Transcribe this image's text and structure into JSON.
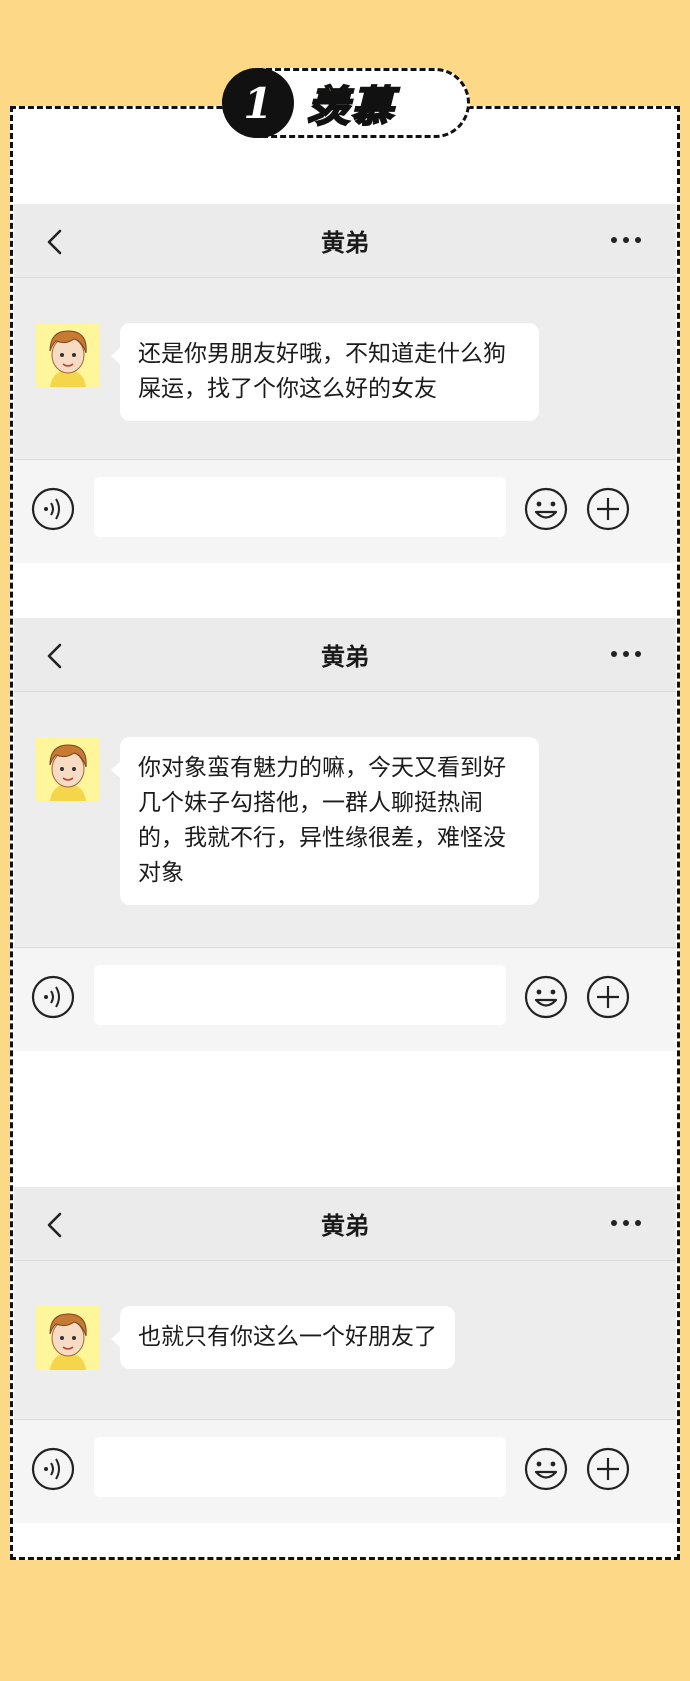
{
  "badge": {
    "number": "1",
    "text": "羡慕"
  },
  "chats": [
    {
      "title": "黄弟",
      "message": "还是你男朋友好哦，不知道走什么狗屎运，找了个你这么好的女友"
    },
    {
      "title": "黄弟",
      "message": "你对象蛮有魅力的嘛，今天又看到好几个妹子勾搭他，一群人聊挺热闹的，我就不行，异性缘很差，难怪没对象"
    },
    {
      "title": "黄弟",
      "message": "也就只有你这么一个好朋友了"
    }
  ],
  "icons": {
    "back": "chevron-left-icon",
    "more": "more-dots-icon",
    "voice": "voice-icon",
    "emoji": "emoji-icon",
    "plus": "plus-icon"
  },
  "colors": {
    "page_background": "#fdd987",
    "badge_text": "#f8c12a",
    "chat_background": "#ededed",
    "bubble": "#ffffff"
  }
}
